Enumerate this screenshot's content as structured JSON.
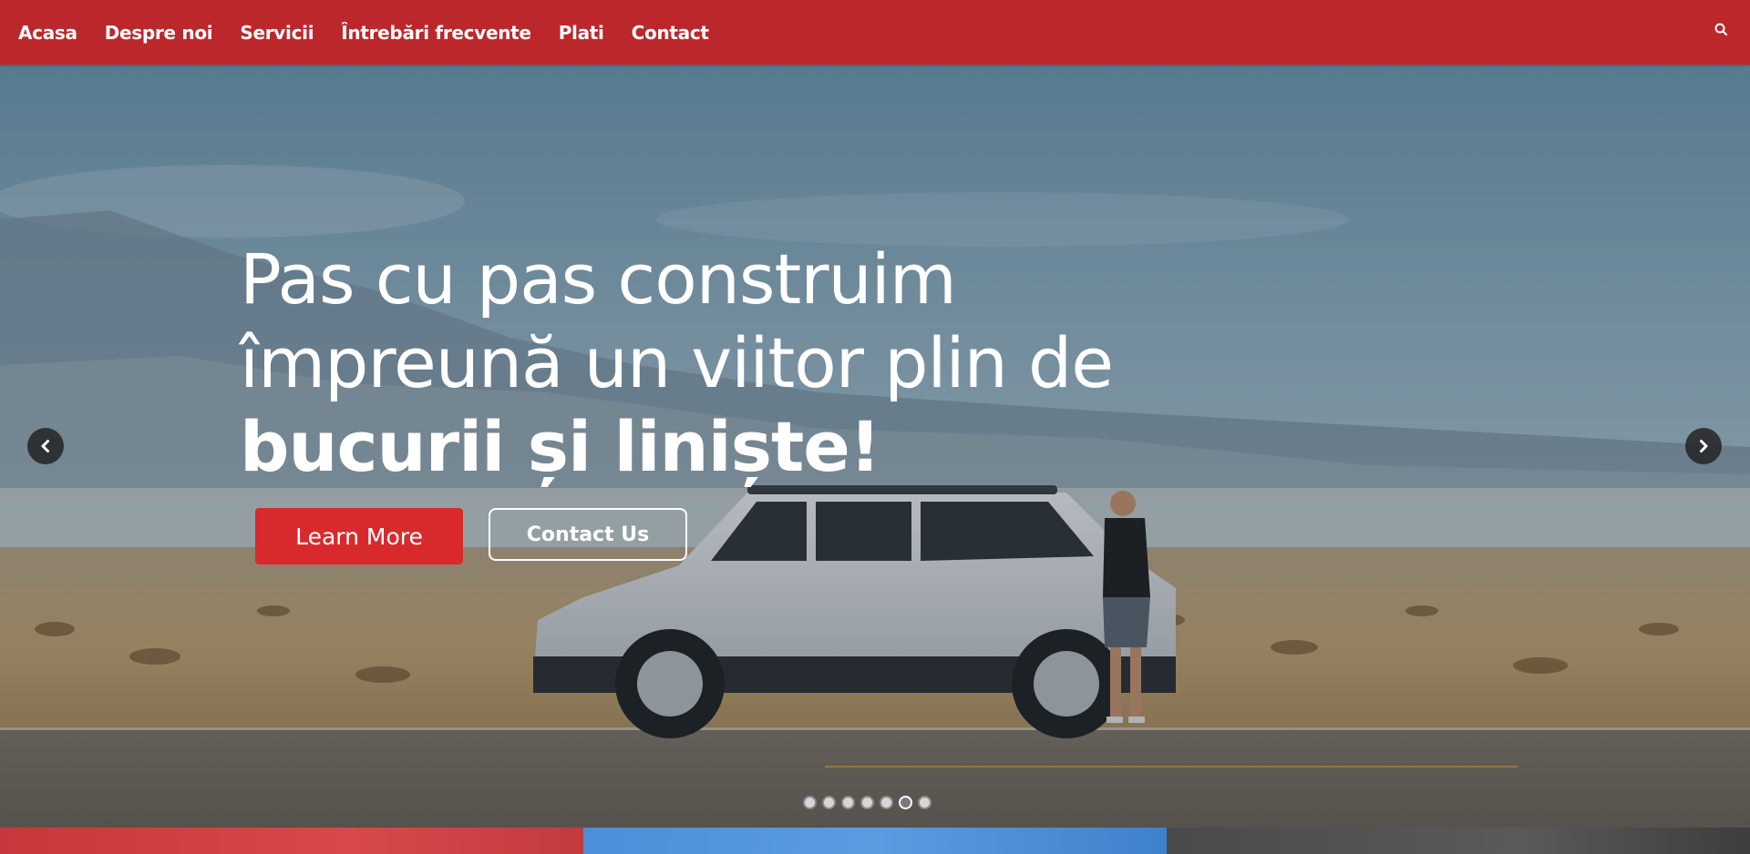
{
  "nav": {
    "items": [
      {
        "label": "Acasa"
      },
      {
        "label": "Despre noi"
      },
      {
        "label": "Servicii"
      },
      {
        "label": "Întrebări frecvente"
      },
      {
        "label": "Plati"
      },
      {
        "label": "Contact"
      }
    ],
    "search_icon": "search-icon"
  },
  "hero": {
    "headline_line1": "Pas cu pas construim",
    "headline_line2": "împreună un viitor plin de",
    "headline_line3": "bucurii și liniște!",
    "learn_more_label": "Learn More",
    "contact_us_label": "Contact Us",
    "prev_icon": "chevron-left-icon",
    "next_icon": "chevron-right-icon"
  },
  "slider": {
    "slide_count": 7,
    "active_index": 5
  },
  "colors": {
    "nav_bg": "#bc272c",
    "primary_button": "#d82a2c"
  }
}
